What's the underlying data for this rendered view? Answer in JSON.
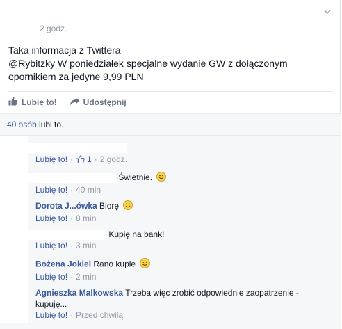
{
  "post": {
    "timestamp": "2 godz.",
    "lines": [
      "Taka informacja z Twittera",
      "@Rybitzky W poniedziałek specjalne wydanie GW z dołączonym",
      "opornikiem za jedyne 9,99 PLN"
    ]
  },
  "actions": {
    "like": "Lubię to!",
    "share": "Udostępnij"
  },
  "likes_summary": {
    "count_link": "40 osób",
    "suffix": " lubi to."
  },
  "comments": [
    {
      "author": "",
      "text": "",
      "like": "Lubię to!",
      "likes": "1",
      "time": "2 godz."
    },
    {
      "author": "",
      "text": "Świetnie.",
      "like": "Lubię to!",
      "time": "40 min"
    },
    {
      "author": "Dorota J...ówka",
      "text": "Biorę",
      "like": "Lubię to!",
      "time": "8 min"
    },
    {
      "author": "",
      "text": "Kupię na bank!",
      "like": "Lubię to!",
      "time": "3 min"
    },
    {
      "author": "Bożena Jokiel",
      "text": "Rano kupie",
      "like": "Lubię to!",
      "time": "2 min"
    },
    {
      "author": "Agnieszka Malkowska",
      "text": "Trzeba więc zrobić odpowiednie zaopatrzenie -",
      "text_cont": "kupuję...",
      "like": "Lubię to!",
      "time": "Przed chwilą"
    }
  ],
  "colors": {
    "link": "#3b5998",
    "muted": "#9197a3",
    "panel": "#f6f7f9"
  }
}
